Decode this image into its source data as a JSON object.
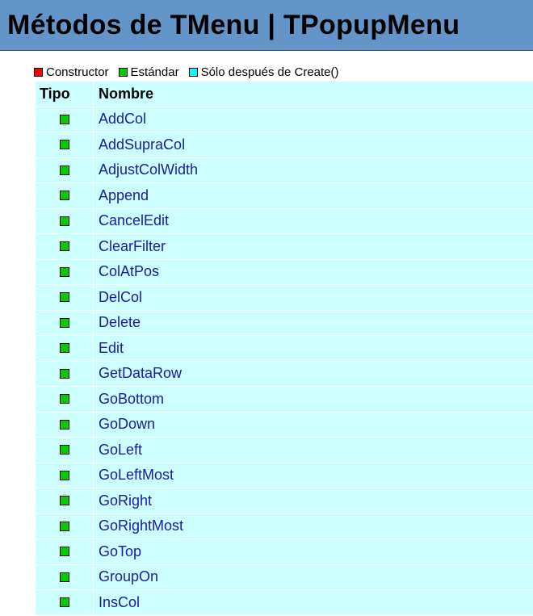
{
  "page": {
    "title": "Métodos de TMenu | TPopupMenu"
  },
  "legend": [
    {
      "label": "Constructor",
      "color": "#ff0000"
    },
    {
      "label": "Estándar",
      "color": "#00cc00"
    },
    {
      "label": "Sólo después de Create()",
      "color": "#00ffff"
    }
  ],
  "table": {
    "headers": {
      "type": "Tipo",
      "name": "Nombre"
    },
    "rows": [
      {
        "type_color": "#00cc00",
        "name": "AddCol"
      },
      {
        "type_color": "#00cc00",
        "name": "AddSupraCol"
      },
      {
        "type_color": "#00cc00",
        "name": "AdjustColWidth"
      },
      {
        "type_color": "#00cc00",
        "name": "Append"
      },
      {
        "type_color": "#00cc00",
        "name": "CancelEdit"
      },
      {
        "type_color": "#00cc00",
        "name": "ClearFilter"
      },
      {
        "type_color": "#00cc00",
        "name": "ColAtPos"
      },
      {
        "type_color": "#00cc00",
        "name": "DelCol"
      },
      {
        "type_color": "#00cc00",
        "name": "Delete"
      },
      {
        "type_color": "#00cc00",
        "name": "Edit"
      },
      {
        "type_color": "#00cc00",
        "name": "GetDataRow"
      },
      {
        "type_color": "#00cc00",
        "name": "GoBottom"
      },
      {
        "type_color": "#00cc00",
        "name": "GoDown"
      },
      {
        "type_color": "#00cc00",
        "name": "GoLeft"
      },
      {
        "type_color": "#00cc00",
        "name": "GoLeftMost"
      },
      {
        "type_color": "#00cc00",
        "name": "GoRight"
      },
      {
        "type_color": "#00cc00",
        "name": "GoRightMost"
      },
      {
        "type_color": "#00cc00",
        "name": "GoTop"
      },
      {
        "type_color": "#00cc00",
        "name": "GroupOn"
      },
      {
        "type_color": "#00cc00",
        "name": "InsCol"
      }
    ]
  }
}
